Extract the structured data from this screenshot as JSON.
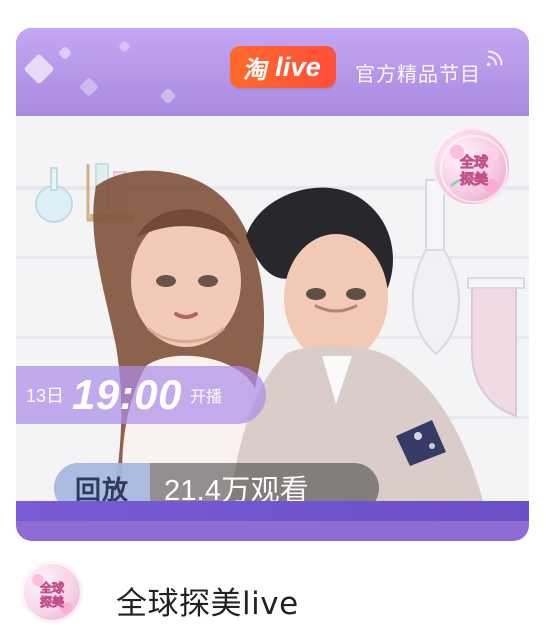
{
  "card": {
    "brand_cn": "淘",
    "brand_live": "live",
    "official_program": "官方精品节目",
    "schedule": {
      "date": "13日",
      "time": "19:00",
      "start": "开播"
    },
    "replay": {
      "label": "回放",
      "views": "21.4万观看"
    },
    "show_badge_text": "全球探美"
  },
  "footer": {
    "channel_name": "全球探美live",
    "avatar_text": "全球探美"
  },
  "colors": {
    "topband": "#B79AE9",
    "taobao_orange": "#FF5A33",
    "purple_strip": "#6B4FC6",
    "replay_chip": "#B1C3F1",
    "replay_bar": "#3C3C3C"
  }
}
